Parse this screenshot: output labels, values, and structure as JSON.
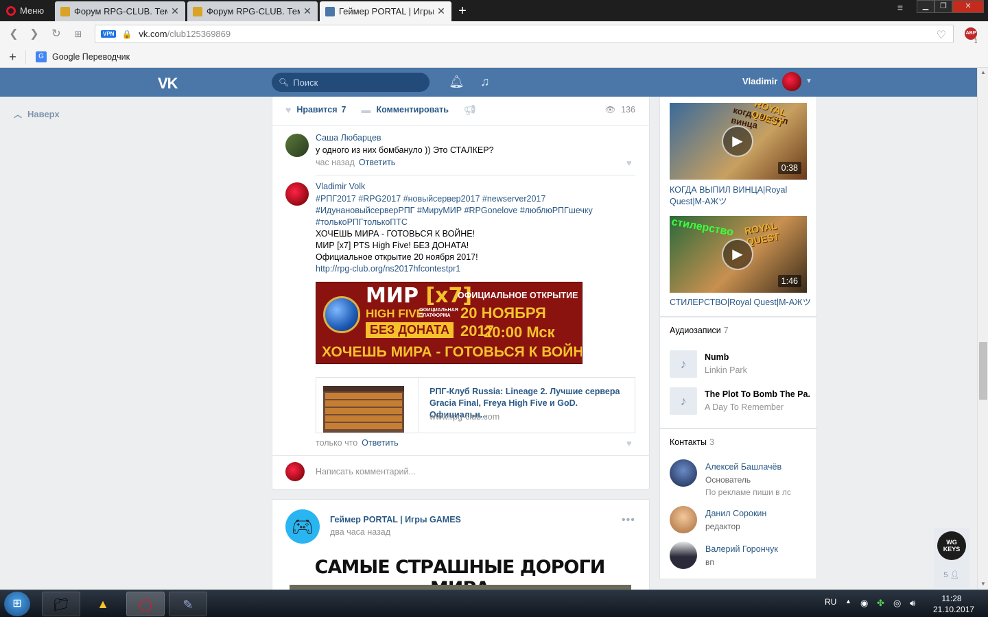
{
  "browser": {
    "menu_label": "Меню",
    "tabs": [
      {
        "title": "Форум RPG-CLUB. Тема: N"
      },
      {
        "title": "Форум RPG-CLUB. Тема: N"
      },
      {
        "title": "Геймер PORTAL | Игры G"
      }
    ],
    "url_host": "vk.com",
    "url_path": "/club125369869",
    "vpn_label": "VPN",
    "abp_label": "ABP",
    "abp_badge": "1",
    "bookmark": "Google Переводчик"
  },
  "vk": {
    "search_placeholder": "Поиск",
    "user_name": "Vladimir",
    "to_top": "Наверх"
  },
  "post": {
    "like_label": "Нравится",
    "like_count": "7",
    "comment_label": "Комментировать",
    "views": "136",
    "comments": [
      {
        "author": "Саша Любарцев",
        "text": "у одного из них бомбануло )) Это СТАЛКЕР?",
        "time": "час назад",
        "reply": "Ответить"
      },
      {
        "author": "Vladimir Volk",
        "hashtags_1": "#РПГ2017 #RPG2017 #новыйсервер2017 #newserver2017",
        "hashtags_2": "#ИдунановыйсерверРПГ #МируМИР #RPGonelove #люблюРПГшечку",
        "hashtags_3": "#толькоРПГтолькоПТС",
        "line_1": "ХОЧЕШЬ МИРА - ГОТОВЬСЯ К ВОЙНЕ!",
        "line_2": "МИР [x7] PTS High Five! БЕЗ ДОНАТА!",
        "line_3": "Официальное открытие 20 ноября 2017!",
        "link": "http://rpg-club.org/ns2017hfcontestpr1",
        "time": "только что",
        "reply": "Ответить"
      }
    ],
    "banner": {
      "mir": "МИР",
      "x7": "[x7]",
      "hf": "HIGH FIVE",
      "platform": "ОФИЦИАЛЬНАЯ ПЛАТФОРМА",
      "bez": "БЕЗ ДОНАТА",
      "official": "ОФИЦИАЛЬНОЕ ОТКРЫТИЕ",
      "date": "20 НОЯБРЯ 2017",
      "time": "20:00 Мск",
      "bottom": "ХОЧЕШЬ МИРА - ГОТОВЬСЯ К ВОЙНЕ"
    },
    "snippet": {
      "title": "РПГ-Клуб Russia: Lineage 2. Лучшие сервера Gracia Final, Freya High Five и GoD. Официальн...",
      "domain": "www.rpg-club.com"
    },
    "write_placeholder": "Написать комментарий..."
  },
  "post2": {
    "author": "Геймер PORTAL | Игры GAMES",
    "time": "два часа назад",
    "image_title": "САМЫЕ СТРАШНЫЕ ДОРОГИ МИРА"
  },
  "sidebar": {
    "videos": [
      {
        "title": "КОГДА ВЫПИЛ ВИНЦА|Royal Quest|М-АЖツ",
        "duration": "0:38",
        "overlay": "когда выпил винца",
        "brand": "ROYAL QUEST"
      },
      {
        "title": "СТИЛЕРСТВО|Royal Quest|М-АЖツ",
        "duration": "1:46",
        "overlay": "стилерство",
        "brand": "ROYAL QUEST"
      }
    ],
    "audio_title": "Аудиозаписи",
    "audio_count": "7",
    "audio": [
      {
        "name": "Numb",
        "artist": "Linkin Park"
      },
      {
        "name": "The Plot To Bomb The Pa...",
        "artist": "A Day To Remember"
      }
    ],
    "contacts_title": "Контакты",
    "contacts_count": "3",
    "contacts": [
      {
        "name": "Алексей Башлачёв",
        "role": "Основатель",
        "sub": "По рекламе пиши в лс"
      },
      {
        "name": "Данил Сорокин",
        "role": "редактор",
        "sub": ""
      },
      {
        "name": "Валерий Горончук",
        "role": "вп",
        "sub": ""
      }
    ],
    "wg_logo": "WG KEYS",
    "wg_count": "5"
  },
  "taskbar": {
    "lang": "RU",
    "time": "11:28",
    "date": "21.10.2017"
  }
}
